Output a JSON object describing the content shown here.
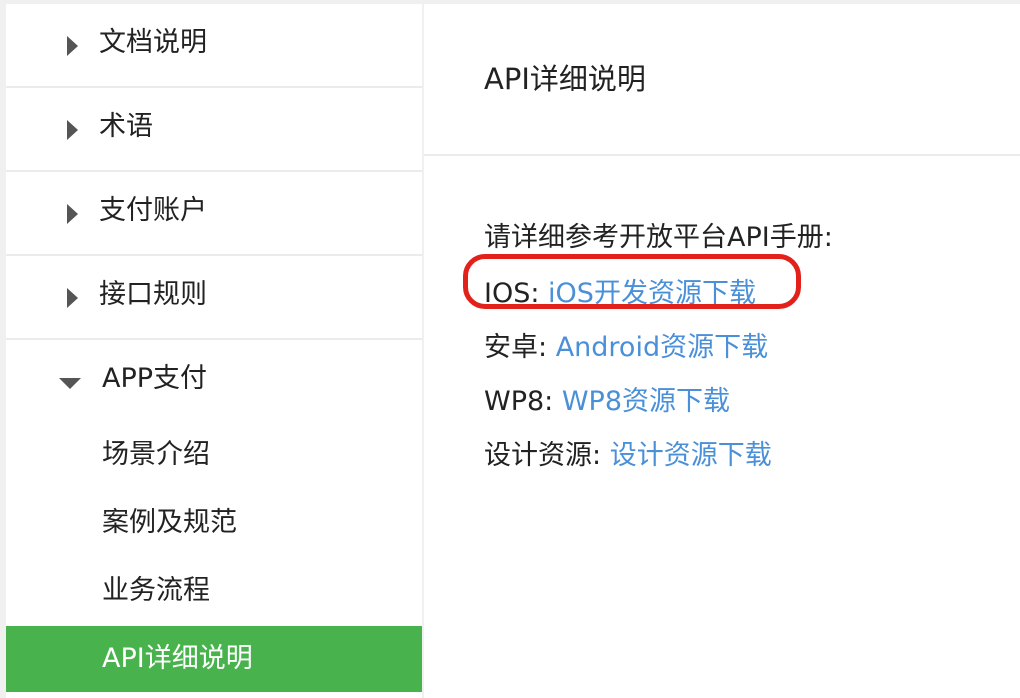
{
  "sidebar": {
    "items": [
      {
        "label": "文档说明",
        "expanded": false
      },
      {
        "label": "术语",
        "expanded": false
      },
      {
        "label": "支付账户",
        "expanded": false
      },
      {
        "label": "接口规则",
        "expanded": false
      },
      {
        "label": "APP支付",
        "expanded": true
      }
    ],
    "subitems": [
      {
        "label": "场景介绍",
        "active": false
      },
      {
        "label": "案例及规范",
        "active": false
      },
      {
        "label": "业务流程",
        "active": false
      },
      {
        "label": "API详细说明",
        "active": true
      }
    ]
  },
  "main": {
    "title": "API详细说明",
    "intro": "请详细参考开放平台API手册:",
    "downloads": [
      {
        "label": "IOS:",
        "link": "iOS开发资源下载",
        "highlighted": true
      },
      {
        "label": "安卓:",
        "link": "Android资源下载",
        "highlighted": false
      },
      {
        "label": "WP8:",
        "link": "WP8资源下载",
        "highlighted": false
      },
      {
        "label": "设计资源:",
        "link": "设计资源下载",
        "highlighted": false
      }
    ]
  },
  "colors": {
    "active_bg": "#48b34d",
    "link": "#4a90d9",
    "highlight_ring": "#e3211b"
  }
}
